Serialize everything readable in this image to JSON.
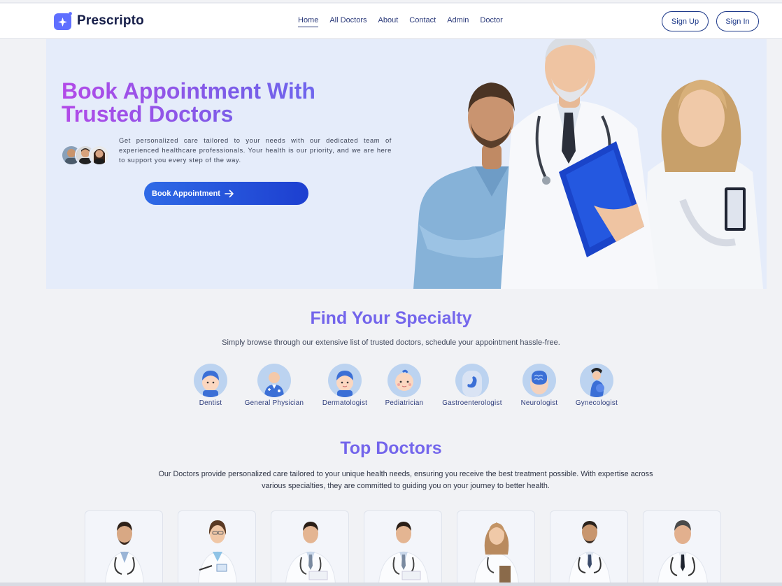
{
  "nav": {
    "logo_text": "Prescripto",
    "links": [
      "Home",
      "All Doctors",
      "About",
      "Contact",
      "Admin",
      "Doctor"
    ],
    "active_link": "Home",
    "signup_label": "Sign Up",
    "signin_label": "Sign In"
  },
  "hero": {
    "title_line1": "Book Appointment With",
    "title_line2": "Trusted Doctors",
    "description": "Get personalized care tailored to your needs with our dedicated team of experienced healthcare professionals. Your health is our priority, and we are here to support you every step of the way.",
    "button_label": "Book Appointment"
  },
  "specialty": {
    "title": "Find Your Specialty",
    "subtitle": "Simply browse through our extensive list of trusted doctors, schedule your appointment hassle-free.",
    "items": [
      "Dentist",
      "General Physician",
      "Dermatologist",
      "Pediatrician",
      "Gastroenterologist",
      "Neurologist",
      "Gynecologist"
    ]
  },
  "top_doctors": {
    "title": "Top Doctors",
    "description": "Our Doctors provide personalized care tailored to your unique health needs, ensuring you receive the best treatment possible. With expertise across various specialties, they are committed to guiding you on your journey to better health."
  },
  "colors": {
    "brand": "#5f6fff",
    "gradient_start": "#b34ae8",
    "button_blue": "#1d3fd0",
    "hero_bg": "#e5ecfa"
  }
}
